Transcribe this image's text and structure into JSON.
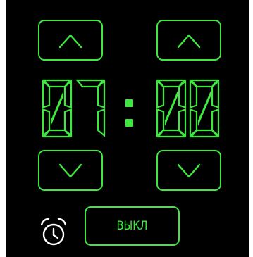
{
  "clock": {
    "hours": "07",
    "minutes": "00",
    "separator": ":"
  },
  "controls": {
    "hours_up": "chevron-up-icon",
    "minutes_up": "chevron-up-icon",
    "hours_down": "chevron-down-icon",
    "minutes_down": "chevron-down-icon"
  },
  "alarm": {
    "icon": "alarm-clock-icon",
    "state_label": "ВЫКЛ"
  },
  "colors": {
    "accent": "#3ee83e",
    "background": "#000000"
  }
}
